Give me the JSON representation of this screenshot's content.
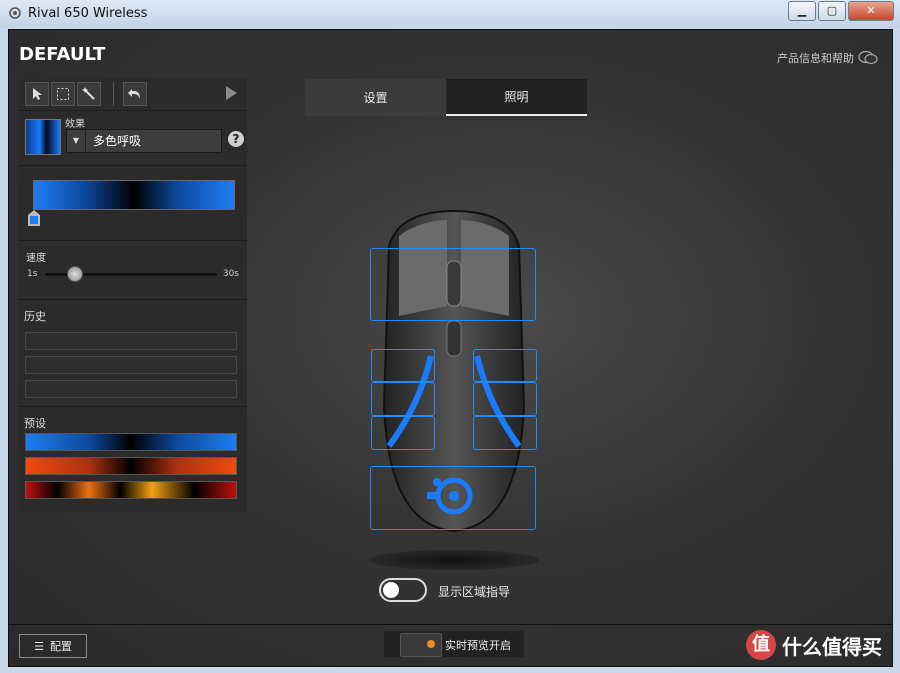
{
  "window": {
    "title": "Rival 650 Wireless"
  },
  "header": {
    "profile_name": "DEFAULT",
    "help_label": "产品信息和帮助"
  },
  "panel": {
    "effect_label": "效果",
    "effect_value": "多色呼吸",
    "help_symbol": "?",
    "speed_label": "速度",
    "speed_min": "1s",
    "speed_max": "30s",
    "speed_value_fraction": 0.17,
    "history_label": "历史",
    "presets_label": "预设"
  },
  "tabs": [
    {
      "label": "设置",
      "active": false
    },
    {
      "label": "照明",
      "active": true
    }
  ],
  "colors": {
    "accent": "#1f8bff",
    "zone_glow": "#1a7bff",
    "preview_led": "#f08a20"
  },
  "toggle": {
    "label": "显示区域指导",
    "on": false
  },
  "footer": {
    "config_label": "配置",
    "preview_label": "实时预览开启"
  },
  "watermark": {
    "symbol": "值",
    "text": "什么值得买"
  }
}
